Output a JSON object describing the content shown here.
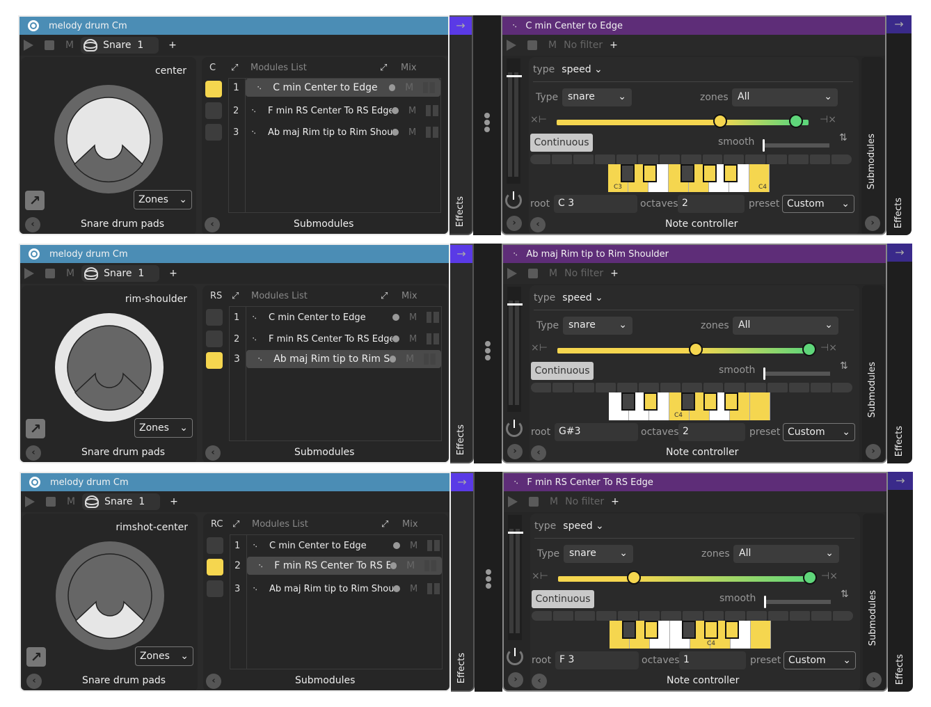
{
  "rows": [
    {
      "device": {
        "title": "melody drum Cm",
        "play_label": "",
        "m_label": "M",
        "instrument": "Snare",
        "instrument_index": "1",
        "add_label": "+",
        "zone_label": "center",
        "zone_code": "C",
        "zones_select": "Zones",
        "footer": "Snare drum pads",
        "submodules_header": "Modules List",
        "mix_header": "Mix",
        "submodules_footer": "Submodules",
        "active_zone": "center",
        "active_led": 0,
        "selected_item": 0,
        "items": [
          {
            "num": "1",
            "name": "C min Center to Edge",
            "m": "M"
          },
          {
            "num": "2",
            "name": "F min RS Center To RS Edge",
            "m": "M"
          },
          {
            "num": "3",
            "name": "Ab maj Rim tip to Rim Shou",
            "m": "M"
          }
        ],
        "effects_label": "Effects"
      },
      "module": {
        "title": "C min Center to Edge",
        "m_label": "M",
        "filter": "No filter",
        "add_label": "+",
        "type_label": "type",
        "type_value": "speed",
        "Type_label": "Type",
        "Type_value": "snare",
        "zones_label": "zones",
        "zones_value": "All",
        "continuous_label": "Continuous",
        "smooth_label": "smooth",
        "range_low": 0.65,
        "range_high": 0.95,
        "root_label": "root",
        "root_value": "C 3",
        "octaves_label": "octaves",
        "octaves_value": "2",
        "preset_label": "preset",
        "preset_value": "Custom",
        "footer": "Note controller",
        "submodules_tab": "Submodules",
        "effects_tab": "Effects",
        "keys_start_label": "C3",
        "keys_end_label": "C4"
      }
    },
    {
      "device": {
        "title": "melody drum Cm",
        "m_label": "M",
        "instrument": "Snare",
        "instrument_index": "1",
        "add_label": "+",
        "zone_label": "rim-shoulder",
        "zone_code": "RS",
        "zones_select": "Zones",
        "footer": "Snare drum pads",
        "submodules_header": "Modules List",
        "mix_header": "Mix",
        "submodules_footer": "Submodules",
        "active_zone": "rim",
        "active_led": 2,
        "selected_item": 2,
        "items": [
          {
            "num": "1",
            "name": "C min Center to Edge",
            "m": "M"
          },
          {
            "num": "2",
            "name": "F min RS Center To RS Edge",
            "m": "M"
          },
          {
            "num": "3",
            "name": "Ab maj Rim tip to Rim Shou",
            "m": "M"
          }
        ],
        "effects_label": "Effects"
      },
      "module": {
        "title": "Ab maj Rim tip to Rim Shoulder",
        "m_label": "M",
        "filter": "No filter",
        "add_label": "+",
        "type_label": "type",
        "type_value": "speed",
        "Type_label": "Type",
        "Type_value": "snare",
        "zones_label": "zones",
        "zones_value": "All",
        "continuous_label": "Continuous",
        "smooth_label": "smooth",
        "range_low": 0.55,
        "range_high": 1.0,
        "root_label": "root",
        "root_value": "G#3",
        "octaves_label": "octaves",
        "octaves_value": "2",
        "preset_label": "preset",
        "preset_value": "Custom",
        "footer": "Note controller",
        "submodules_tab": "Submodules",
        "effects_tab": "Effects",
        "keys_start_label": "",
        "keys_end_label": "C4"
      }
    },
    {
      "device": {
        "title": "melody drum Cm",
        "m_label": "M",
        "instrument": "Snare",
        "instrument_index": "1",
        "add_label": "+",
        "zone_label": "rimshot-center",
        "zone_code": "RC",
        "zones_select": "Zones",
        "footer": "Snare drum pads",
        "submodules_header": "Modules List",
        "mix_header": "Mix",
        "submodules_footer": "Submodules",
        "active_zone": "rimshot",
        "active_led": 1,
        "selected_item": 1,
        "items": [
          {
            "num": "1",
            "name": "C min Center to Edge",
            "m": "M"
          },
          {
            "num": "2",
            "name": "F min RS Center To RS Edge",
            "m": "M"
          },
          {
            "num": "3",
            "name": "Ab maj Rim tip to Rim Shou",
            "m": "M"
          }
        ],
        "effects_label": "Effects"
      },
      "module": {
        "title": "F min RS Center To RS Edge",
        "m_label": "M",
        "filter": "No filter",
        "add_label": "+",
        "type_label": "type",
        "type_value": "speed",
        "Type_label": "Type",
        "Type_value": "snare",
        "zones_label": "zones",
        "zones_value": "All",
        "continuous_label": "Continuous",
        "smooth_label": "smooth",
        "range_low": 0.3,
        "range_high": 1.0,
        "root_label": "root",
        "root_value": "F 3",
        "octaves_label": "octaves",
        "octaves_value": "1",
        "preset_label": "preset",
        "preset_value": "Custom",
        "footer": "Note controller",
        "submodules_tab": "Submodules",
        "effects_tab": "Effects",
        "keys_start_label": "",
        "keys_end_label": "C4"
      }
    }
  ],
  "colors": {
    "device_header": "#4b8db5",
    "module_header": "#5e2d78",
    "accent_yellow": "#f5d64f",
    "accent_green": "#5fd67a",
    "led_on": "#f5d64f"
  }
}
